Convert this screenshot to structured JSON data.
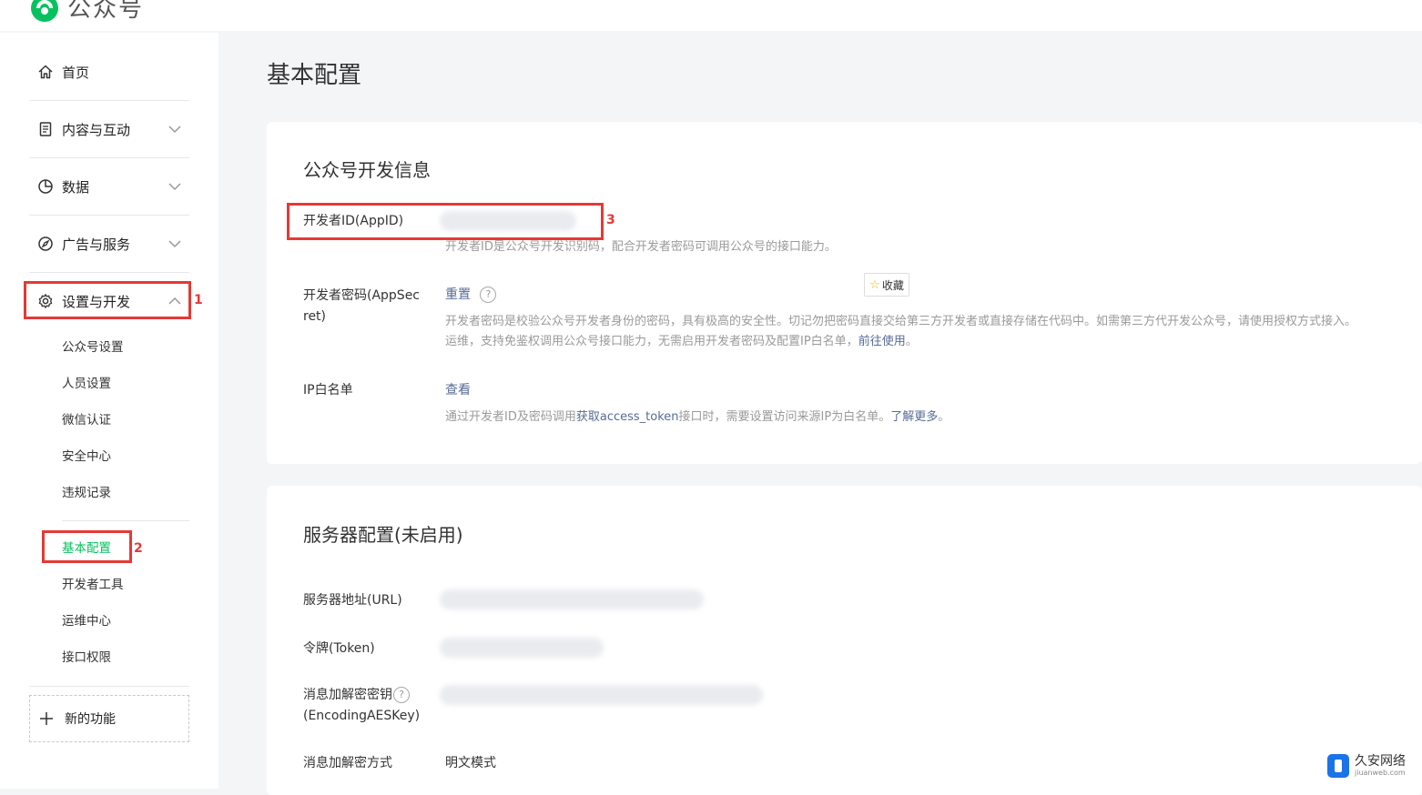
{
  "app": {
    "title": "公众号",
    "brand_color": "#07c160",
    "logo_icon": "wechat-official-account-logo"
  },
  "sidebar": {
    "home": "首页",
    "content": "内容与互动",
    "data": "数据",
    "ads": "广告与服务",
    "settings": "设置与开发",
    "sub_items": [
      "公众号设置",
      "人员设置",
      "微信认证",
      "安全中心",
      "违规记录"
    ],
    "dev_items": [
      "基本配置",
      "开发者工具",
      "运维中心",
      "接口权限"
    ],
    "new_feature": "新的功能",
    "active_item": "基本配置"
  },
  "annotations": {
    "tag1": "1",
    "tag2": "2",
    "tag3": "3",
    "color": "#e53935"
  },
  "main": {
    "page_title": "基本配置",
    "dev_info": {
      "title": "公众号开发信息",
      "appid_label": "开发者ID(AppID)",
      "appid_desc": "开发者ID是公众号开发识别码，配合开发者密码可调用公众号的接口能力。",
      "secret_label_1": "开发者密码(AppSec",
      "secret_label_2": "ret)",
      "secret_action": "重置",
      "help_mark": "?",
      "secret_desc_1": "开发者密码是校验公众号开发者身份的密码，具有极高的安全性。切记勿把密码直接交给第三方开发者或直接存储在代码中。如需第三方代开发公众号，请使用授权方式接入。",
      "secret_desc_2": "运维，支持免鉴权调用公众号接口能力，无需启用开发者密码及配置IP白名单，",
      "secret_desc_link": "前往使用",
      "secret_desc_end": "。",
      "ip_label": "IP白名单",
      "ip_action": "查看",
      "ip_desc_1": "通过开发者ID及密码调用",
      "ip_desc_link1": "获取access_token",
      "ip_desc_2": "接口时，需要设置访问来源IP为白名单。",
      "ip_desc_link2": "了解更多",
      "ip_desc_end": "。",
      "fav_button": "收藏"
    },
    "server": {
      "title": "服务器配置(未启用)",
      "url_label": "服务器地址(URL)",
      "token_label": "令牌(Token)",
      "aes_label_1": "消息加解密密钥",
      "aes_label_2": "(EncodingAESKey)",
      "mode_label": "消息加解密方式",
      "mode_value": "明文模式"
    }
  },
  "watermark": {
    "cn": "久安网络",
    "en": "jiuanweb.com"
  }
}
